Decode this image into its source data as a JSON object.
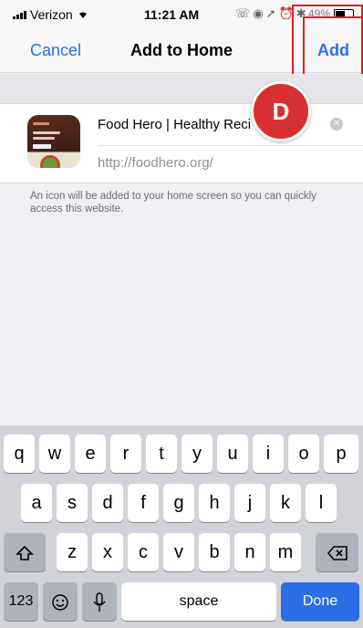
{
  "status_bar": {
    "carrier": "Verizon",
    "time": "11:21 AM",
    "battery": "49%"
  },
  "nav": {
    "cancel_label": "Cancel",
    "title": "Add to Home",
    "add_label": "Add"
  },
  "card": {
    "title_value": "Food Hero | Healthy Reci",
    "url": "http://foodhero.org/"
  },
  "hint_text": "An icon will be added to your home screen so you can quickly access this website.",
  "annotation": {
    "badge_label": "D",
    "highlight_color": "#e02020"
  },
  "keyboard": {
    "row1": [
      "q",
      "w",
      "e",
      "r",
      "t",
      "y",
      "u",
      "i",
      "o",
      "p"
    ],
    "row2": [
      "a",
      "s",
      "d",
      "f",
      "g",
      "h",
      "j",
      "k",
      "l"
    ],
    "row3": [
      "z",
      "x",
      "c",
      "v",
      "b",
      "n",
      "m"
    ],
    "numbers_key": "123",
    "space_key": "space",
    "done_key": "Done",
    "shift_icon": "shift-icon",
    "backspace_icon": "backspace-icon",
    "emoji_icon": "emoji-icon",
    "mic_icon": "microphone-icon"
  },
  "colors": {
    "accent": "#2b6ee8",
    "badge": "#d83030"
  }
}
